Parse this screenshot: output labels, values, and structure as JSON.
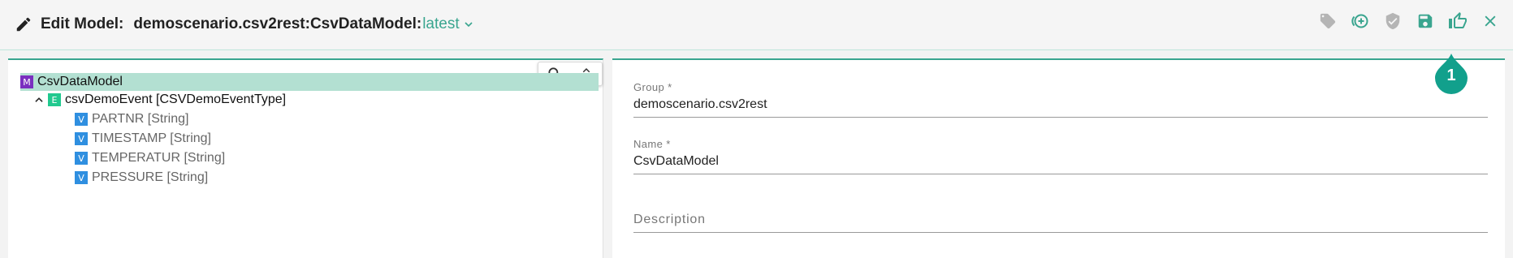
{
  "header": {
    "title_label": "Edit Model:",
    "model_path": "demoscenario.csv2rest:CsvDataModel:",
    "version": "latest"
  },
  "actions": [
    {
      "name": "tag-icon"
    },
    {
      "name": "add-circle-icon"
    },
    {
      "name": "verified-icon"
    },
    {
      "name": "save-icon"
    },
    {
      "name": "thumbs-up-icon"
    },
    {
      "name": "close-icon"
    }
  ],
  "badge": {
    "count": "1"
  },
  "tree": {
    "root": {
      "badge": "M",
      "label": "CsvDataModel"
    },
    "event": {
      "badge": "E",
      "label": "csvDemoEvent [CSVDemoEventType]"
    },
    "attributes": [
      {
        "badge": "V",
        "label": "PARTNR [String]"
      },
      {
        "badge": "V",
        "label": "TIMESTAMP [String]"
      },
      {
        "badge": "V",
        "label": "TEMPERATUR [String]"
      },
      {
        "badge": "V",
        "label": "PRESSURE [String]"
      }
    ]
  },
  "form": {
    "group": {
      "label": "Group *",
      "value": "demoscenario.csv2rest"
    },
    "name": {
      "label": "Name *",
      "value": "CsvDataModel"
    },
    "description": {
      "label": "Description",
      "value": ""
    }
  },
  "colors": {
    "accent": "#3aa58f",
    "selection": "#b3e0d2",
    "model_badge": "#7a2fbf",
    "event_badge": "#21c98f",
    "attr_badge": "#2f8fe0"
  }
}
